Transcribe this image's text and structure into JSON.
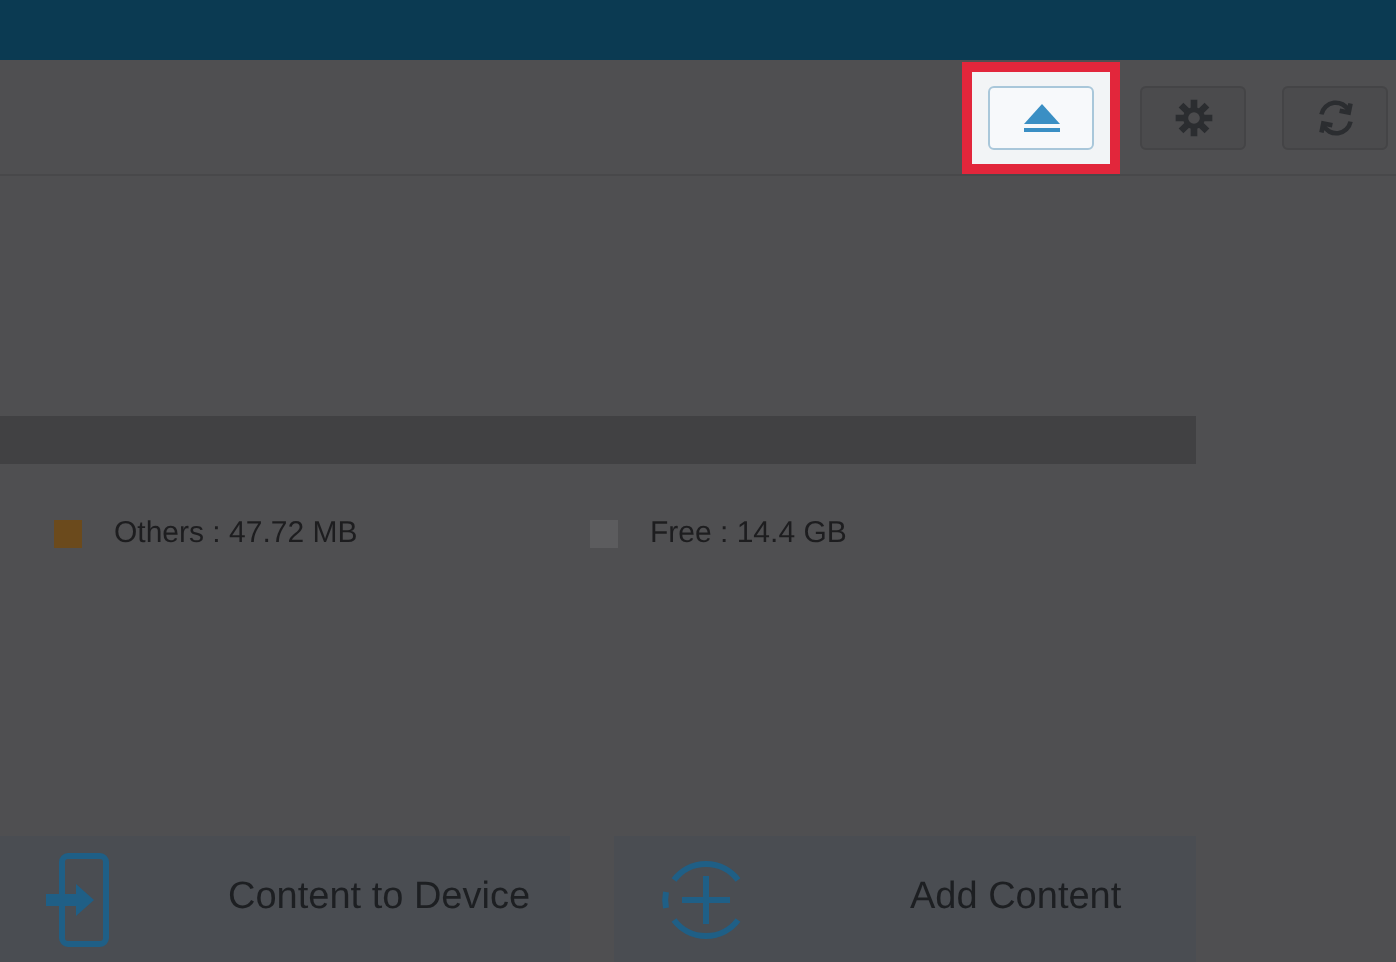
{
  "toolbar": {
    "buttons": [
      {
        "kind": "eject",
        "highlighted": true
      },
      {
        "kind": "settings",
        "highlighted": false
      },
      {
        "kind": "sync",
        "highlighted": false
      }
    ]
  },
  "storage_legend": [
    {
      "label": "Others : 47.72 MB",
      "color": "#6b4a1c"
    },
    {
      "label": "Free : 14.4 GB",
      "color": "#5c5c5e"
    }
  ],
  "actions": [
    {
      "kind": "to-device",
      "label": "Content to Device"
    },
    {
      "kind": "add",
      "label": "Add Content"
    }
  ]
}
